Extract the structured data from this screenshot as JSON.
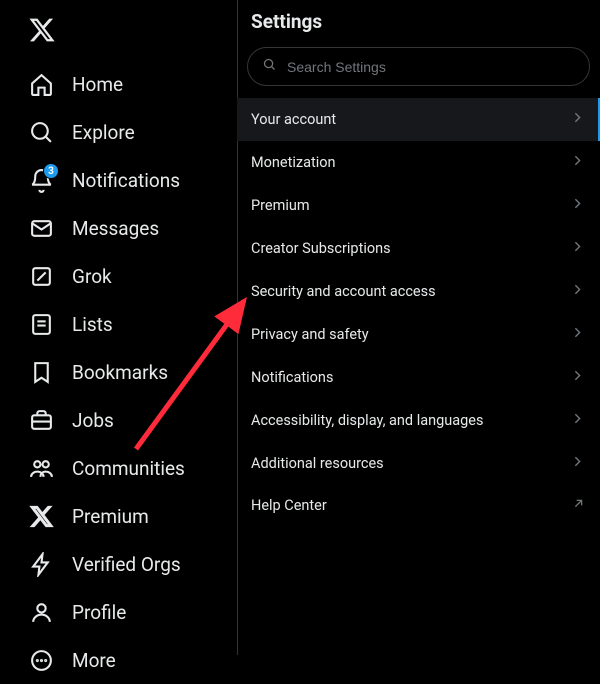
{
  "sidebar": {
    "items": [
      {
        "label": "Home"
      },
      {
        "label": "Explore"
      },
      {
        "label": "Notifications",
        "badge": "3"
      },
      {
        "label": "Messages"
      },
      {
        "label": "Grok"
      },
      {
        "label": "Lists"
      },
      {
        "label": "Bookmarks"
      },
      {
        "label": "Jobs"
      },
      {
        "label": "Communities"
      },
      {
        "label": "Premium"
      },
      {
        "label": "Verified Orgs"
      },
      {
        "label": "Profile"
      },
      {
        "label": "More"
      }
    ]
  },
  "settings": {
    "title": "Settings",
    "search_placeholder": "Search Settings",
    "items": [
      {
        "label": "Your account",
        "selected": true
      },
      {
        "label": "Monetization"
      },
      {
        "label": "Premium"
      },
      {
        "label": "Creator Subscriptions"
      },
      {
        "label": "Security and account access"
      },
      {
        "label": "Privacy and safety"
      },
      {
        "label": "Notifications"
      },
      {
        "label": "Accessibility, display, and languages"
      },
      {
        "label": "Additional resources"
      },
      {
        "label": "Help Center",
        "external": true
      }
    ]
  },
  "annotation": {
    "arrow_color": "#ff2b3a"
  }
}
